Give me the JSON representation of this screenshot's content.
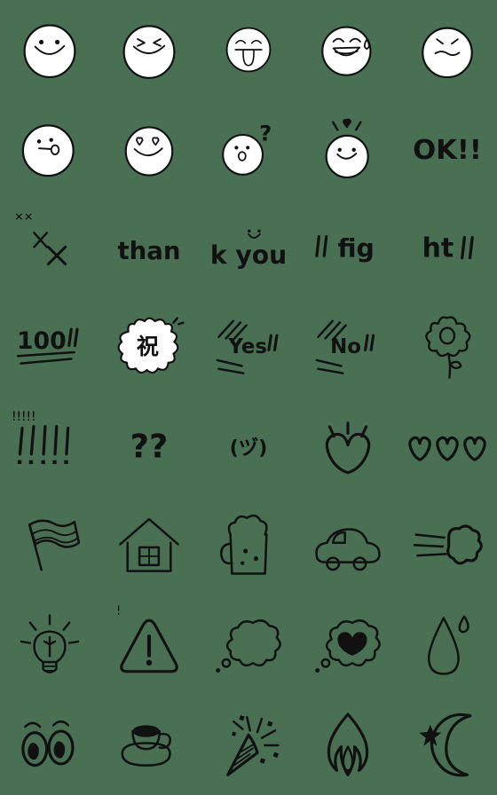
{
  "sheet": {
    "title": "Handwritten Doodle Emoji Sticker Sheet",
    "background_color": "#4a7054",
    "ink_color": "#111111",
    "face_fill_color": "#ffffff",
    "columns": 5,
    "rows": 8,
    "total_items": 40
  },
  "items": [
    {
      "id": "r1c1",
      "icon": "smiling-face-icon",
      "label": "smiling face",
      "text": ""
    },
    {
      "id": "r1c2",
      "icon": "squinting-happy-face-icon",
      "label": "squinting happy face",
      "text": ""
    },
    {
      "id": "r1c3",
      "icon": "tongue-out-face-icon",
      "label": "face with tongue out",
      "text": ""
    },
    {
      "id": "r1c4",
      "icon": "laughing-sweat-face-icon",
      "label": "laughing face with sweat drop",
      "text": ""
    },
    {
      "id": "r1c5",
      "icon": "annoyed-face-icon",
      "label": "annoyed face",
      "text": ""
    },
    {
      "id": "r2c1",
      "icon": "whistling-face-icon",
      "label": "whistling face",
      "text": ""
    },
    {
      "id": "r2c2",
      "icon": "heart-eyes-face-icon",
      "label": "heart eyes face",
      "text": ""
    },
    {
      "id": "r2c3",
      "icon": "confused-question-face-icon",
      "label": "confused face with question",
      "text": "?"
    },
    {
      "id": "r2c4",
      "icon": "face-with-heart-above-icon",
      "label": "happy face with heart above",
      "text": ""
    },
    {
      "id": "r2c5",
      "icon": "ok-text-icon",
      "label": "OK text",
      "text": "OK!!"
    },
    {
      "id": "r3c1",
      "icon": "double-x-mark-icon",
      "label": "two x marks",
      "text": "××"
    },
    {
      "id": "r3c2",
      "icon": "thank-text-icon",
      "label": "than text",
      "text": "than"
    },
    {
      "id": "r3c3",
      "icon": "kyou-text-icon",
      "label": "k you text with smiley",
      "text": "k you"
    },
    {
      "id": "r3c4",
      "icon": "fig-text-icon",
      "label": "fig text",
      "text": "fig"
    },
    {
      "id": "r3c5",
      "icon": "ht-text-icon",
      "label": "ht text",
      "text": "ht"
    },
    {
      "id": "r4c1",
      "icon": "hundred-points-icon",
      "label": "100 underlined",
      "text": "100"
    },
    {
      "id": "r4c2",
      "icon": "celebration-kanji-burst-icon",
      "label": "celebration kanji in burst",
      "text": "祝"
    },
    {
      "id": "r4c3",
      "icon": "yes-text-icon",
      "label": "Yes text with emphasis lines",
      "text": "Yes"
    },
    {
      "id": "r4c4",
      "icon": "no-text-icon",
      "label": "No text with emphasis lines",
      "text": "No"
    },
    {
      "id": "r4c5",
      "icon": "flower-icon",
      "label": "flower",
      "text": ""
    },
    {
      "id": "r5c1",
      "icon": "multiple-exclamation-icon",
      "label": "five exclamation marks",
      "text": "!!!!!"
    },
    {
      "id": "r5c2",
      "icon": "double-question-icon",
      "label": "two question marks",
      "text": "??"
    },
    {
      "id": "r5c3",
      "icon": "kaomoji-shrug-icon",
      "label": "kaomoji face in parentheses",
      "text": "(ヅ)"
    },
    {
      "id": "r5c4",
      "icon": "sparkling-heart-icon",
      "label": "sparkling heart",
      "text": ""
    },
    {
      "id": "r5c5",
      "icon": "three-hearts-icon",
      "label": "three hearts in a row",
      "text": ""
    },
    {
      "id": "r6c1",
      "icon": "flag-icon",
      "label": "waving flag",
      "text": ""
    },
    {
      "id": "r6c2",
      "icon": "house-icon",
      "label": "house",
      "text": ""
    },
    {
      "id": "r6c3",
      "icon": "beer-mug-icon",
      "label": "beer mug",
      "text": ""
    },
    {
      "id": "r6c4",
      "icon": "car-icon",
      "label": "car",
      "text": ""
    },
    {
      "id": "r6c5",
      "icon": "dash-puff-icon",
      "label": "dash puff of air",
      "text": ""
    },
    {
      "id": "r7c1",
      "icon": "light-bulb-icon",
      "label": "light bulb idea",
      "text": ""
    },
    {
      "id": "r7c2",
      "icon": "warning-triangle-icon",
      "label": "warning triangle",
      "text": "!"
    },
    {
      "id": "r7c3",
      "icon": "thought-bubble-icon",
      "label": "empty thought bubble",
      "text": ""
    },
    {
      "id": "r7c4",
      "icon": "thought-bubble-heart-icon",
      "label": "thought bubble with heart",
      "text": ""
    },
    {
      "id": "r7c5",
      "icon": "water-drop-icon",
      "label": "water drop",
      "text": ""
    },
    {
      "id": "r8c1",
      "icon": "eyes-icon",
      "label": "pair of eyes",
      "text": ""
    },
    {
      "id": "r8c2",
      "icon": "coffee-cup-icon",
      "label": "coffee cup on saucer",
      "text": ""
    },
    {
      "id": "r8c3",
      "icon": "party-popper-icon",
      "label": "party popper",
      "text": ""
    },
    {
      "id": "r8c4",
      "icon": "flame-icon",
      "label": "flame",
      "text": ""
    },
    {
      "id": "r8c5",
      "icon": "crescent-moon-star-icon",
      "label": "crescent moon with star",
      "text": ""
    }
  ]
}
